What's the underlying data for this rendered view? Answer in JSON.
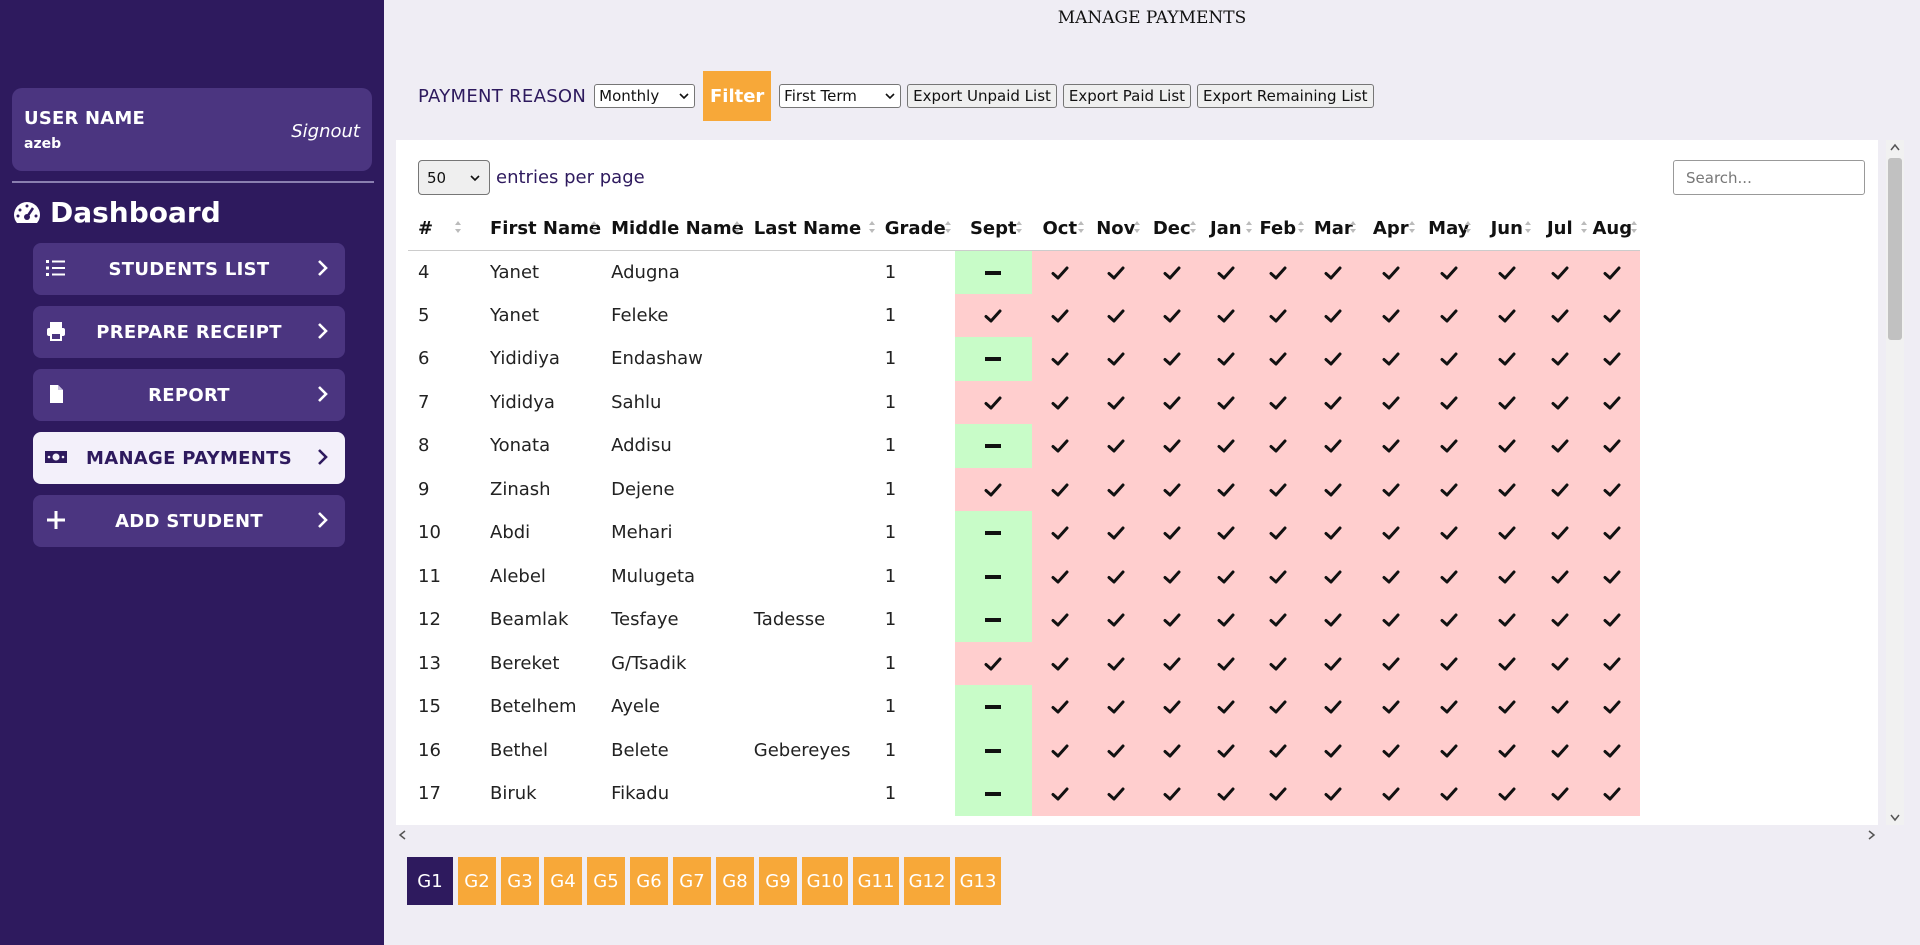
{
  "user": {
    "label": "USER NAME",
    "name": "azeb",
    "signout": "Signout"
  },
  "dashboard_title": "Dashboard",
  "nav": [
    {
      "label": "STUDENTS LIST",
      "icon": "list-icon"
    },
    {
      "label": "PREPARE RECEIPT",
      "icon": "print-icon"
    },
    {
      "label": "REPORT",
      "icon": "file-icon"
    },
    {
      "label": "MANAGE PAYMENTS",
      "icon": "money-icon",
      "active": true
    },
    {
      "label": "ADD STUDENT",
      "icon": "plus-icon"
    }
  ],
  "page_title": "MANAGE PAYMENTS",
  "toolbar": {
    "reason_label": "PAYMENT REASON",
    "reason_value": "Monthly",
    "filter_label": "Filter",
    "term_value": "First Term",
    "export_unpaid": "Export Unpaid List",
    "export_paid": "Export Paid List",
    "export_remaining": "Export Remaining List"
  },
  "table_controls": {
    "entries_value": "50",
    "entries_text": "entries per page",
    "search_placeholder": "Search..."
  },
  "columns": [
    "#",
    "First Name",
    "Middle Name",
    "Last Name",
    "Grade",
    "Sept",
    "Oct",
    "Nov",
    "Dec",
    "Jan",
    "Feb",
    "Mar",
    "Apr",
    "May",
    "Jun",
    "Jul",
    "Aug"
  ],
  "rows": [
    {
      "id": "4",
      "first": "Yanet",
      "middle": "Adugna",
      "last": "",
      "grade": "1",
      "sept": "dash"
    },
    {
      "id": "5",
      "first": "Yanet",
      "middle": "Feleke",
      "last": "",
      "grade": "1",
      "sept": "check"
    },
    {
      "id": "6",
      "first": "Yididiya",
      "middle": "Endashaw",
      "last": "",
      "grade": "1",
      "sept": "dash"
    },
    {
      "id": "7",
      "first": "Yididya",
      "middle": "Sahlu",
      "last": "",
      "grade": "1",
      "sept": "check"
    },
    {
      "id": "8",
      "first": "Yonata",
      "middle": "Addisu",
      "last": "",
      "grade": "1",
      "sept": "dash"
    },
    {
      "id": "9",
      "first": "Zinash",
      "middle": "Dejene",
      "last": "",
      "grade": "1",
      "sept": "check"
    },
    {
      "id": "10",
      "first": "Abdi",
      "middle": "Mehari",
      "last": "",
      "grade": "1",
      "sept": "dash"
    },
    {
      "id": "11",
      "first": "Alebel",
      "middle": "Mulugeta",
      "last": "",
      "grade": "1",
      "sept": "dash"
    },
    {
      "id": "12",
      "first": "Beamlak",
      "middle": "Tesfaye",
      "last": "Tadesse",
      "grade": "1",
      "sept": "dash"
    },
    {
      "id": "13",
      "first": "Bereket",
      "middle": "G/Tsadik",
      "last": "",
      "grade": "1",
      "sept": "check"
    },
    {
      "id": "15",
      "first": "Betelhem",
      "middle": "Ayele",
      "last": "",
      "grade": "1",
      "sept": "dash"
    },
    {
      "id": "16",
      "first": "Bethel",
      "middle": "Belete",
      "last": "Gebereyes",
      "grade": "1",
      "sept": "dash"
    },
    {
      "id": "17",
      "first": "Biruk",
      "middle": "Fikadu",
      "last": "",
      "grade": "1",
      "sept": "dash"
    }
  ],
  "colors": {
    "paid": "#c8fcc8",
    "unpaid": "#ffcece",
    "brand": "#2e1a5e",
    "accent": "#f7a839"
  },
  "grades": [
    "G1",
    "G2",
    "G3",
    "G4",
    "G5",
    "G6",
    "G7",
    "G8",
    "G9",
    "G10",
    "G11",
    "G12",
    "G13"
  ],
  "active_grade": "G1"
}
